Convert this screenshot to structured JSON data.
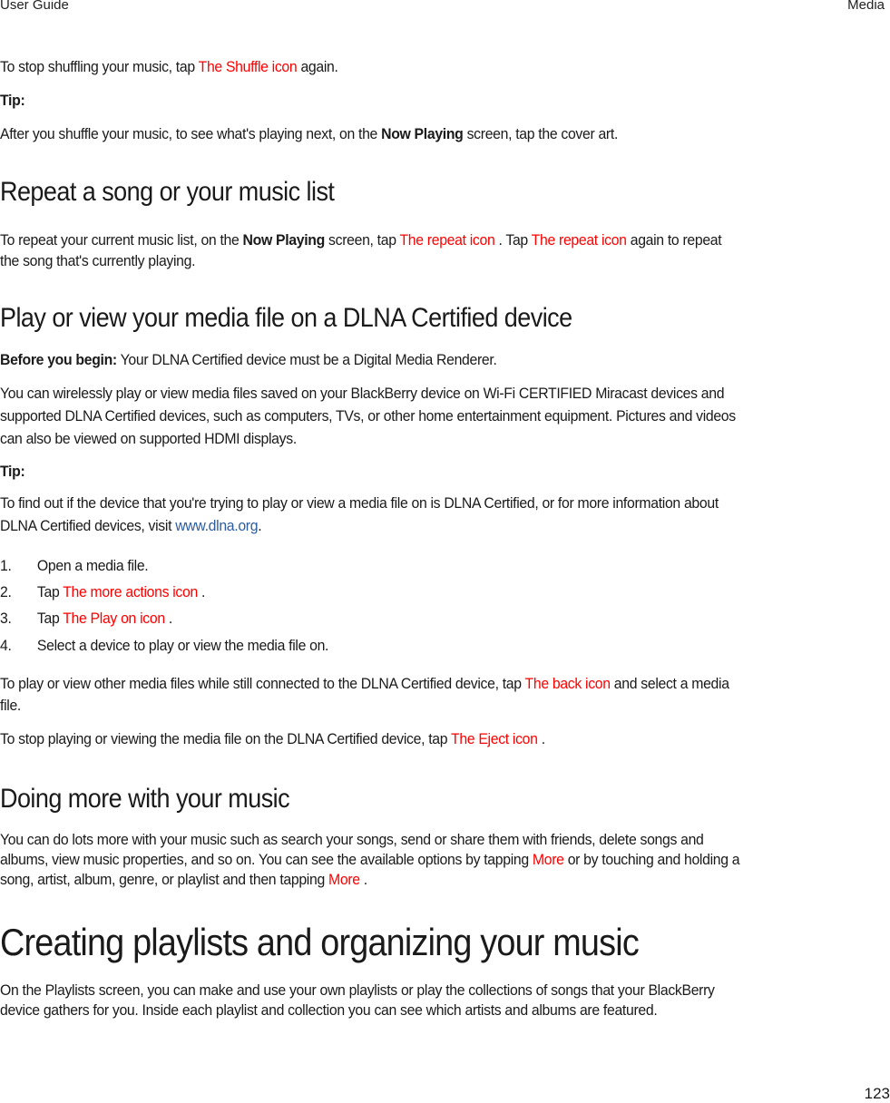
{
  "header": {
    "left": "User Guide",
    "right": "Media"
  },
  "intro": {
    "stop_shuffle_pre": "To stop shuffling your music, tap ",
    "stop_shuffle_icon": "The Shuffle icon",
    "stop_shuffle_post": " again.",
    "tip_label": "Tip:",
    "tip_pre": "After you shuffle your music, to see what's playing next, on the ",
    "tip_bold": "Now Playing",
    "tip_post": " screen, tap the cover art."
  },
  "repeat": {
    "heading": "Repeat a song or your music list",
    "p_pre": "To repeat your current music list, on the ",
    "p_bold": "Now Playing",
    "p_mid1": " screen, tap ",
    "icon1": "The repeat icon",
    "p_mid2": " . Tap ",
    "icon2": "The repeat icon",
    "p_post": " again to repeat",
    "p_line2": "the song that's currently playing."
  },
  "dlna": {
    "heading": "Play or view your media file on a DLNA Certified device",
    "before_label": "Before you begin:",
    "before_text": " Your DLNA Certified device must be a Digital Media Renderer.",
    "body_lines": [
      "You can wirelessly play or view media files saved on your BlackBerry device on Wi-Fi CERTIFIED Miracast devices and",
      "supported DLNA Certified devices, such as computers, TVs, or other home entertainment equipment. Pictures and videos",
      "can also be viewed on supported HDMI displays."
    ],
    "tip_label": "Tip:",
    "tip_line1": "To find out if the device that you're trying to play or view a media file on is DLNA Certified, or for more information about",
    "tip_line2_pre": "DLNA Certified devices, visit ",
    "tip_link": "www.dlna.org",
    "tip_line2_post": ".",
    "steps": [
      {
        "num": "1.",
        "pre": "Open a media file.",
        "icon": "",
        "post": ""
      },
      {
        "num": "2.",
        "pre": "Tap ",
        "icon": "The more actions icon",
        "post": " ."
      },
      {
        "num": "3.",
        "pre": "Tap ",
        "icon": "The Play on icon",
        "post": " ."
      },
      {
        "num": "4.",
        "pre": "Select a device to play or view the media file on.",
        "icon": "",
        "post": ""
      }
    ],
    "other_pre": "To play or view other media files while still connected to the DLNA Certified device, tap ",
    "other_icon": "The back icon",
    "other_post": " and select a media",
    "other_line2": "file.",
    "stop_pre": "To stop playing or viewing the media file on the DLNA Certified device, tap ",
    "stop_icon": "The Eject icon",
    "stop_post": " ."
  },
  "more": {
    "heading": "Doing more with your music",
    "line1": "You can do lots more with your music such as search your songs, send or share them with friends, delete songs and",
    "line2_pre": "albums, view music properties, and so on. You can see the available options by tapping ",
    "line2_icon": "More",
    "line2_post": " or by touching and holding a",
    "line3_pre": "song, artist, album, genre, or playlist and then tapping ",
    "line3_icon": "More",
    "line3_post": " ."
  },
  "playlists": {
    "heading": "Creating playlists and organizing your music",
    "line1": "On the Playlists screen, you can make and use your own playlists or play the collections of songs that your BlackBerry",
    "line2": "device gathers for you. Inside each playlist and collection you can see which artists and albums are featured."
  },
  "footer": {
    "page_number": "123"
  }
}
